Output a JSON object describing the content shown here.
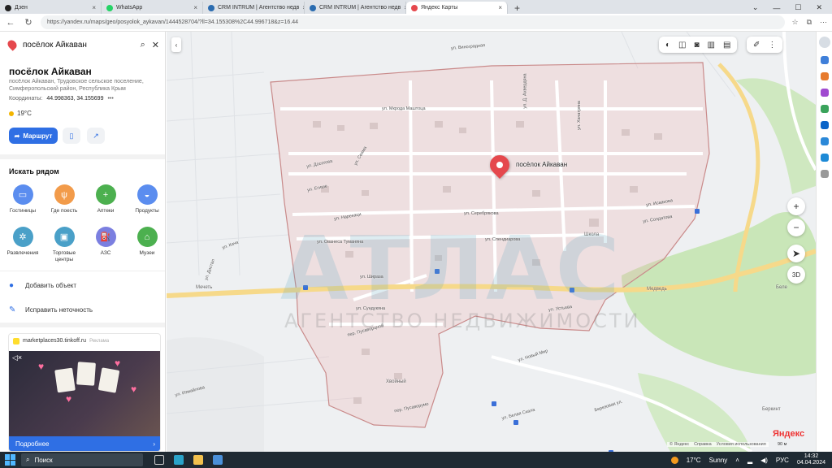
{
  "browser": {
    "tabs": [
      {
        "label": "Дзен",
        "color": "#222222",
        "active": false
      },
      {
        "label": "WhatsApp",
        "color": "#25d366",
        "active": false
      },
      {
        "label": "CRM INTRUM | Агентство недв",
        "color": "#2b6cb0",
        "active": false
      },
      {
        "label": "CRM INTRUM | Агентство недв",
        "color": "#2b6cb0",
        "active": false
      },
      {
        "label": "Яндекс Карты",
        "color": "#e5484d",
        "active": true
      }
    ],
    "new_tab": "+",
    "url": "https://yandex.ru/maps/geo/posyolok_aykavan/1444528704/?ll=34.155308%2C44.996718&z=16.44"
  },
  "panel": {
    "search_value": "посёлок Айкаван",
    "title": "посёлок Айкаван",
    "subtitle": "посёлок Айкаван, Трудовское сельское поселение, Симферопольский район, Республика Крым",
    "coords_label": "Координаты:",
    "coords_value": "44.998363, 34.155699",
    "coords_more": "•••",
    "weather": "19°C",
    "route_label": "Маршрут",
    "nearby_title": "Искать рядом",
    "categories": [
      {
        "label": "Гостиницы",
        "color": "#5b8def",
        "icon": "bed-icon"
      },
      {
        "label": "Где поесть",
        "color": "#f29b4a",
        "icon": "fork-icon"
      },
      {
        "label": "Аптеки",
        "color": "#4cb04f",
        "icon": "pharmacy-icon"
      },
      {
        "label": "Продукты",
        "color": "#5b8def",
        "icon": "basket-icon"
      },
      {
        "label": "Развлечения",
        "color": "#4aa0c8",
        "icon": "fun-icon"
      },
      {
        "label": "Торговые центры",
        "color": "#4aa0c8",
        "icon": "mall-icon"
      },
      {
        "label": "АЗС",
        "color": "#7b7fe0",
        "icon": "fuel-icon"
      },
      {
        "label": "Музеи",
        "color": "#4cb04f",
        "icon": "museum-icon"
      }
    ],
    "add_object": "Добавить объект",
    "fix_error": "Исправить неточность",
    "ad": {
      "domain": "marketplaces30.tinkoff.ru",
      "tag": "Реклама",
      "more": "Подробнее"
    }
  },
  "map": {
    "place_label": "посёлок Айкаван",
    "streets": [
      "ул. Мкрода Маштоца",
      "ул. Д. Ахвердяна",
      "ул. Хачатряна",
      "ул. Досогова",
      "ул. Сеама",
      "ул. Егише",
      "ул. Нарекаци",
      "ул. Серебрякова",
      "ул. Спендиарова",
      "ул. Ованеса Туманяна",
      "ул. Шираза",
      "ул. Сундукяна",
      "ул. Устьева",
      "ул. Исаакова",
      "ул. Солдатова",
      "ул. Кача",
      "ул. Достал",
      "ул. Измайлова",
      "пер. Пусаворцной",
      "ул. Виноградная",
      "ул. Новый Мир",
      "ул. Белая Скала",
      "Березовая ул.",
      "пер. Пусаворумо"
    ],
    "poi": [
      "Школа",
      "Медведь",
      "Мечеть",
      "Хвойный",
      "Беркинт",
      "Беле"
    ],
    "watermark": "АТЛАС",
    "watermark_sub": "АГЕНТСТВО НЕДВИЖИМОСТИ",
    "logo": "Яндекс",
    "copyright": [
      "© Яндекс",
      "Справка",
      "Условия использования"
    ],
    "scale": "90 м",
    "zoom_in": "+",
    "zoom_out": "−",
    "mode_3d": "3D"
  },
  "taskbar": {
    "search": "Поиск",
    "temp": "17°C",
    "weather": "Sunny",
    "lang": "РУС",
    "time": "14:32",
    "date": "04.04.2024"
  }
}
